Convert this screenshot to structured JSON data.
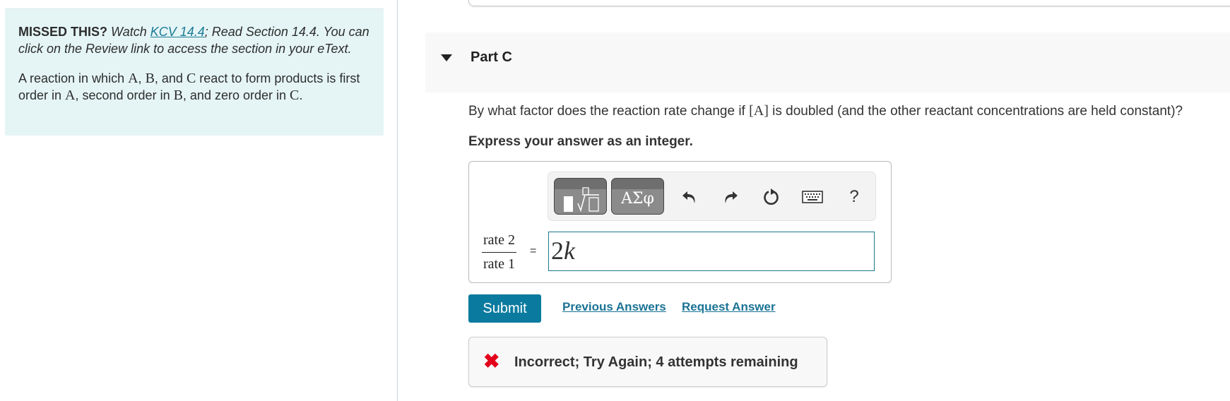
{
  "hint": {
    "missed_label": "MISSED THIS?",
    "watch_prefix": "Watch",
    "video_link": "KCV 14.4",
    "read_text": "; Read Section 14.4. You can click on the Review link to access the section in your eText.",
    "problem_parts": [
      "A reaction in which ",
      "A",
      ", ",
      "B",
      ", and ",
      "C",
      " react to form products is first order in ",
      "A",
      ", second order in ",
      "B",
      ", and zero order in ",
      "C",
      "."
    ]
  },
  "part": {
    "title": "Part C",
    "question_prefix": "By what factor does the reaction rate change if ",
    "question_math": "[A]",
    "question_suffix": " is doubled (and the other reactant concentrations are held constant)?",
    "instruction": "Express your answer as an integer."
  },
  "toolbar": {
    "templates_icon": "templates-icon",
    "symbols_label": "ΑΣφ",
    "undo_icon": "undo-icon",
    "redo_icon": "redo-icon",
    "reset_icon": "reset-icon",
    "keyboard_icon": "keyboard-icon",
    "help_label": "?"
  },
  "answer": {
    "numerator": "rate 2",
    "denominator": "rate 1",
    "equals": "=",
    "value_number": "2",
    "value_variable": "k"
  },
  "actions": {
    "submit": "Submit",
    "previous_answers": "Previous Answers",
    "request_answer": "Request Answer"
  },
  "feedback": {
    "icon": "✖",
    "message": "Incorrect; Try Again; 4 attempts remaining",
    "status_color": "#e3001b"
  }
}
